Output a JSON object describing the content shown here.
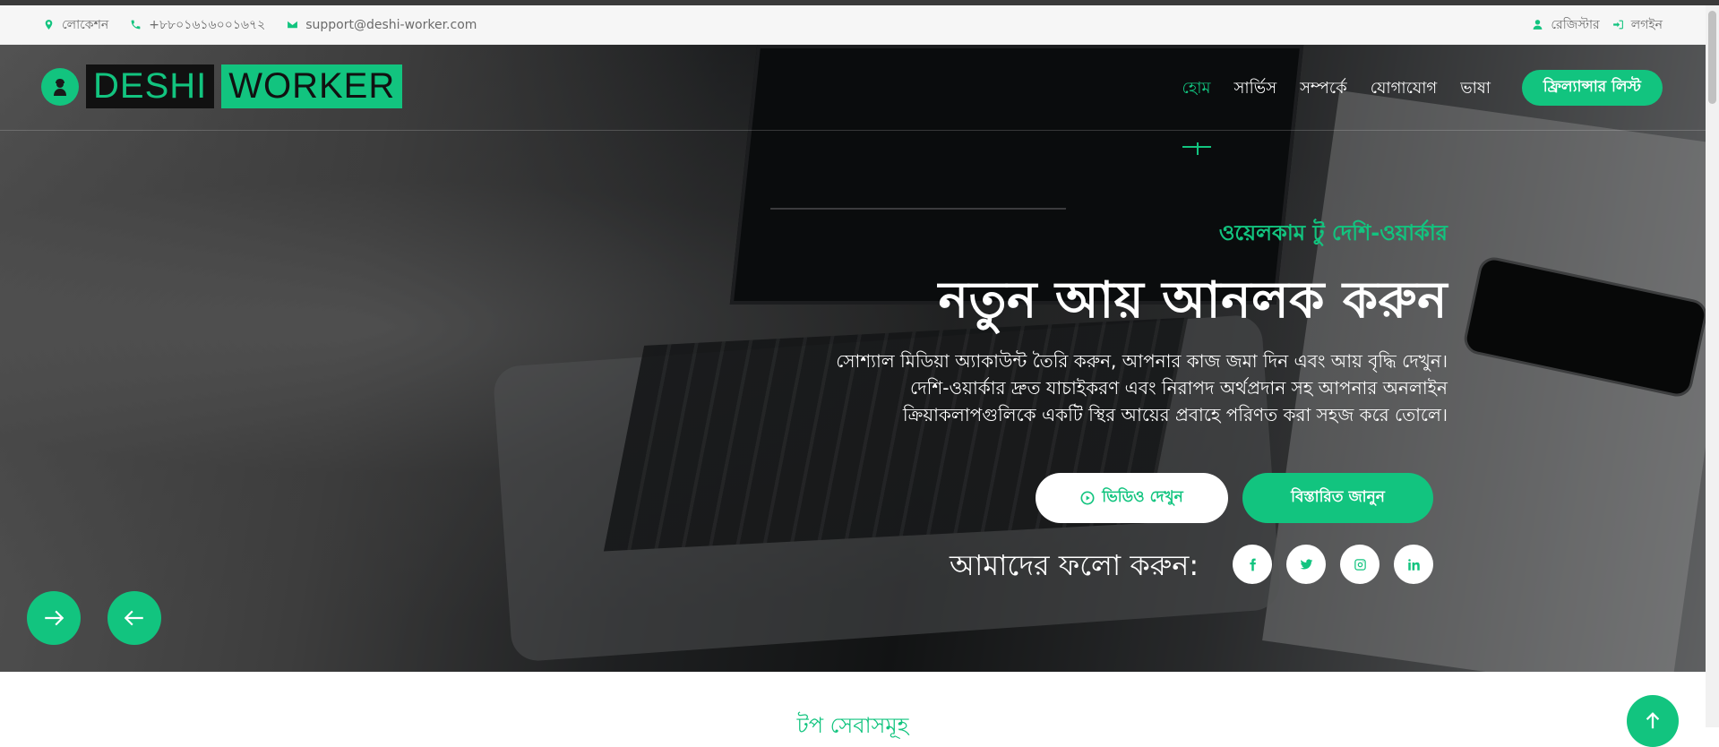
{
  "topbar": {
    "location": "লোকেশন",
    "phone": "+৮৮০১৬১৬০০১৬৭২",
    "email": "support@deshi-worker.com",
    "register": "রেজিস্টার",
    "login": "লগইন"
  },
  "brand": {
    "word1": "DESHI",
    "word2": "WORKER"
  },
  "nav": {
    "items": [
      "হোম",
      "সার্ভিস",
      "সম্পর্কে",
      "যোগাযোগ",
      "ভাষা"
    ],
    "active_index": 0,
    "cta": "ফ্রিল্যান্সার লিস্ট"
  },
  "hero": {
    "tagline": "ওয়েলকাম টু দেশি-ওয়ার্কার",
    "headline": "নতুন আয় আনলক করুন",
    "description_lines": [
      "সোশ্যাল মিডিয়া অ্যাকাউন্ট তৈরি করুন, আপনার কাজ জমা দিন এবং আয় বৃদ্ধি দেখুন।",
      "দেশি-ওয়ার্কার দ্রুত যাচাইকরণ এবং নিরাপদ অর্থপ্রদান সহ আপনার অনলাইন",
      "ক্রিয়াকলাপগুলিকে একটি স্থির আয়ের প্রবাহে পরিণত করা সহজ করে তোলে।"
    ],
    "video_button": "ভিডিও দেখুন",
    "more_button": "বিস্তারিত জানুন",
    "follow_label": "আমাদের ফলো করুন:",
    "social_icons": [
      "facebook-icon",
      "twitter-icon",
      "instagram-icon",
      "linkedin-icon"
    ]
  },
  "section": {
    "title": "টপ সেবাসমূহ"
  },
  "colors": {
    "accent": "#12c47f",
    "topbar_bg": "#f6f6f6",
    "text_light": "#ffffff"
  }
}
